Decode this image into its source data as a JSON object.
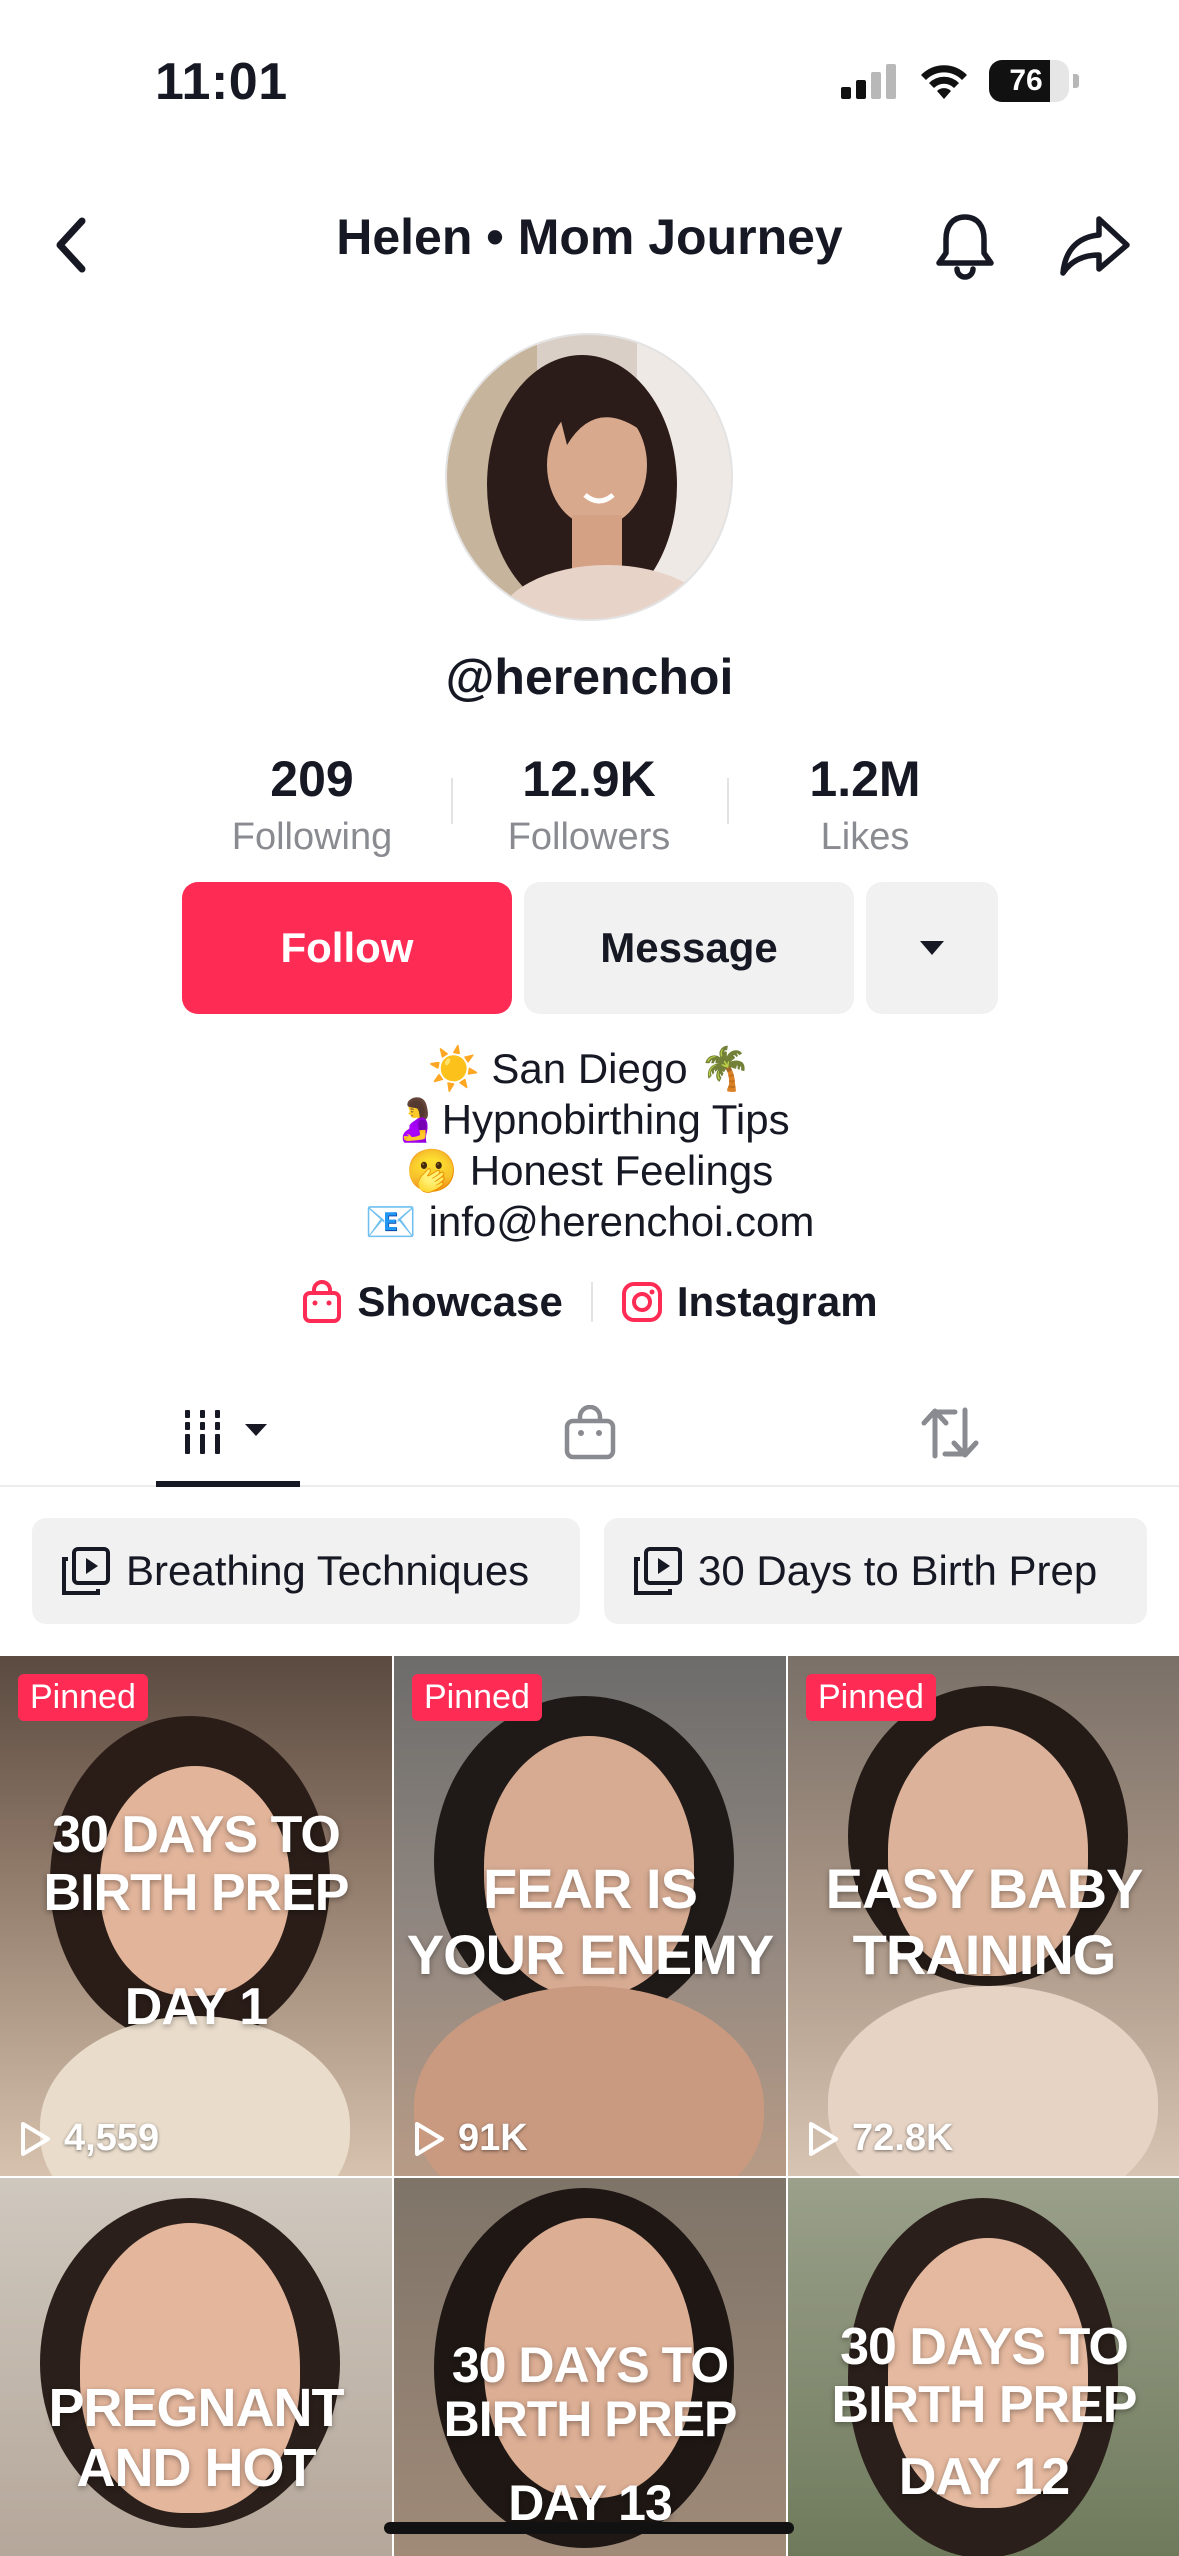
{
  "status_bar": {
    "time": "11:01",
    "battery": "76",
    "battery_level": 0.76
  },
  "header": {
    "title": "Helen • Mom Journey"
  },
  "profile": {
    "username": "@herenchoi",
    "stats": [
      {
        "value": "209",
        "label": "Following"
      },
      {
        "value": "12.9K",
        "label": "Followers"
      },
      {
        "value": "1.2M",
        "label": "Likes"
      }
    ],
    "buttons": {
      "follow": "Follow",
      "message": "Message"
    },
    "bio": [
      {
        "emoji": "☀️",
        "text": "San Diego",
        "emoji_after": "🌴"
      },
      {
        "emoji": "🤰",
        "text": "Hypnobirthing Tips"
      },
      {
        "emoji": "🫢",
        "text": "Honest Feelings"
      },
      {
        "emoji": "📧",
        "text": "info@herenchoi.com"
      }
    ],
    "links": [
      {
        "label": "Showcase",
        "icon": "shopping-bag-icon"
      },
      {
        "label": "Instagram",
        "icon": "instagram-icon"
      }
    ]
  },
  "playlists": [
    {
      "label": "Breathing Techniques"
    },
    {
      "label": "30 Days to Birth Prep"
    }
  ],
  "videos": [
    {
      "pinned": "Pinned",
      "caption": [
        "30 DAYS TO",
        "BIRTH PREP",
        "",
        "DAY 1"
      ],
      "views": "4,559"
    },
    {
      "pinned": "Pinned",
      "caption": [
        "FEAR IS",
        "YOUR ENEMY"
      ],
      "views": "91K"
    },
    {
      "pinned": "Pinned",
      "caption": [
        "EASY BABY",
        "TRAINING"
      ],
      "views": "72.8K"
    },
    {
      "caption": [
        "PREGNANT",
        "AND HOT"
      ]
    },
    {
      "caption": [
        "30 DAYS TO",
        "BIRTH PREP",
        "",
        "DAY 13"
      ]
    },
    {
      "caption": [
        "30 DAYS TO",
        "BIRTH PREP",
        "",
        "DAY 12"
      ]
    }
  ],
  "colors": {
    "accent": "#fe2c55",
    "text": "#161823",
    "muted": "#8a8b91",
    "button_gray": "#f1f1f2"
  }
}
